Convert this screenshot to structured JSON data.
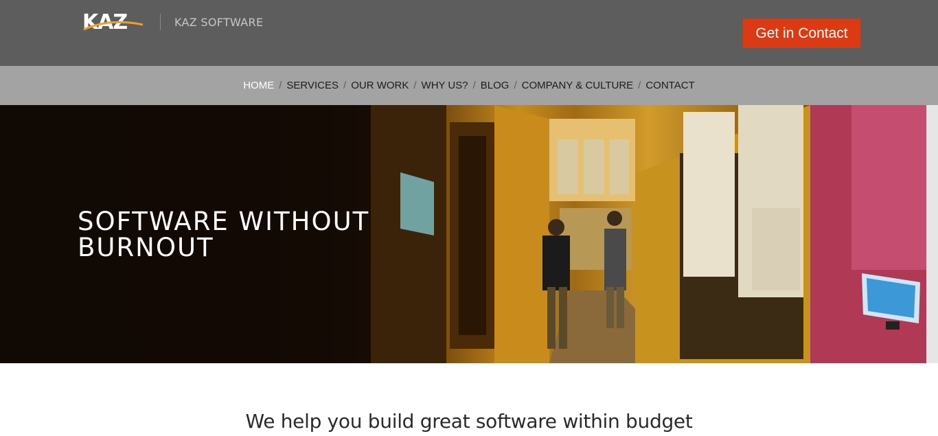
{
  "header": {
    "logo_text": "KAZ",
    "brand_name": "KAZ SOFTWARE",
    "cta_label": "Get in Contact"
  },
  "nav": {
    "items": [
      {
        "label": "HOME",
        "active": true
      },
      {
        "label": "SERVICES",
        "active": false
      },
      {
        "label": "OUR WORK",
        "active": false
      },
      {
        "label": "WHY US?",
        "active": false
      },
      {
        "label": "BLOG",
        "active": false
      },
      {
        "label": "COMPANY & CULTURE",
        "active": false
      },
      {
        "label": "CONTACT",
        "active": false
      }
    ],
    "separator": "/"
  },
  "hero": {
    "title_line1": "SOFTWARE WITHOUT",
    "title_line2": "BURNOUT"
  },
  "tagline": "We help you build great software within budget",
  "colors": {
    "header_bg": "#5d5d5d",
    "nav_bg": "#a3a3a3",
    "cta_bg": "#db3a12",
    "logo_swoosh": "#f0a020"
  }
}
